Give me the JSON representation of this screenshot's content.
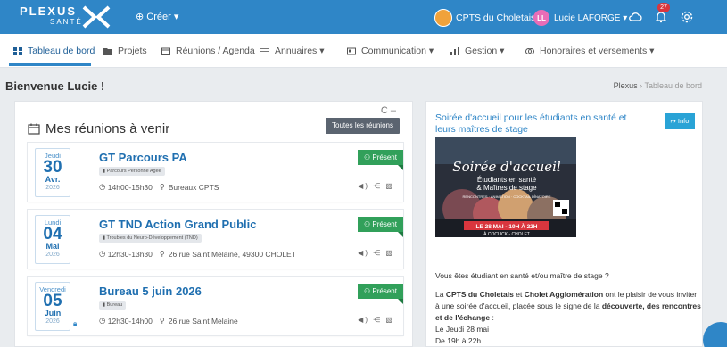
{
  "topbar": {
    "logo_text": "PLEXUS",
    "logo_sub": "SANTÉ",
    "create_label": "⊕ Créer ▾",
    "org_name": "CPTS du Choletais ▾",
    "user_initials": "LL",
    "user_name": "Lucie LAFORGE ▾",
    "notif_count": "27"
  },
  "nav": {
    "items": [
      {
        "label": "Tableau de bord"
      },
      {
        "label": "Projets"
      },
      {
        "label": "Réunions / Agenda"
      },
      {
        "label": "Annuaires ▾"
      },
      {
        "label": "Communication ▾"
      },
      {
        "label": "Gestion ▾"
      },
      {
        "label": "Honoraires et versements ▾"
      }
    ]
  },
  "header": {
    "welcome": "Bienvenue Lucie !",
    "breadcrumb_root": "Plexus",
    "breadcrumb_sep": "›",
    "breadcrumb_current": "Tableau de bord"
  },
  "meetings": {
    "title": "Mes réunions à venir",
    "tools": "C –",
    "all_button": "Toutes les réunions",
    "items": [
      {
        "day": "Jeudi",
        "num": "30",
        "month": "Avr.",
        "year": "2026",
        "title": "GT Parcours PA",
        "tag": "Parcours Personne Agée",
        "time": "14h00-15h30",
        "place": "Bureaux CPTS",
        "status": "Présent",
        "actions": "◀) ⋲ ▧"
      },
      {
        "day": "Lundi",
        "num": "04",
        "month": "Mai",
        "year": "2026",
        "title": "GT TND Action Grand Public",
        "tag": "Troubles du Neuro-Développement (TND)",
        "time": "12h30-13h30",
        "place": "26 rue Saint Mélaine, 49300 CHOLET",
        "status": "Présent",
        "actions": "◀) ⋲ ▧"
      },
      {
        "day": "Vendredi",
        "num": "05",
        "month": "Juin",
        "year": "2026",
        "title": "Bureau 5 juin 2026",
        "tag": "Bureau",
        "time": "12h30-14h00",
        "place": "26 rue Saint Melaine",
        "status": "Présent",
        "actions": "◀) ⋲ ▧"
      }
    ]
  },
  "event": {
    "title": "Soirée d'accueil pour les étudiants en santé et leurs maîtres de stage",
    "info_label": "↦ Info",
    "poster": {
      "title_line": "Soirée d'accueil",
      "subtitle1": "Étudiants en santé",
      "subtitle2": "& Maîtres de stage",
      "subtitle3": "RENCONTRES · ANIMATION · COCKTAIL DÎNATOIRE",
      "date_line": "LE 28 MAI - 19H À 22H",
      "place_line": "À COCLICK - CHOLET"
    },
    "desc_q": "Vous êtes étudiant en santé et/ou maître de stage ?",
    "desc_p1_a": "La ",
    "desc_p1_b": "CPTS du Choletais",
    "desc_p1_c": " et ",
    "desc_p1_d": "Cholet Agglomération",
    "desc_p1_e": " ont le plaisir de vous inviter à une soirée d'accueil, placée sous le signe de la ",
    "desc_p1_f": "découverte, des rencontres et de l'échange",
    "desc_p1_g": " :",
    "desc_date": "Le Jeudi 28 mai",
    "desc_time": "De 19h à 22h"
  },
  "colors": {
    "primary": "#2f86c7",
    "present": "#31a05a",
    "info": "#29a3d6"
  }
}
